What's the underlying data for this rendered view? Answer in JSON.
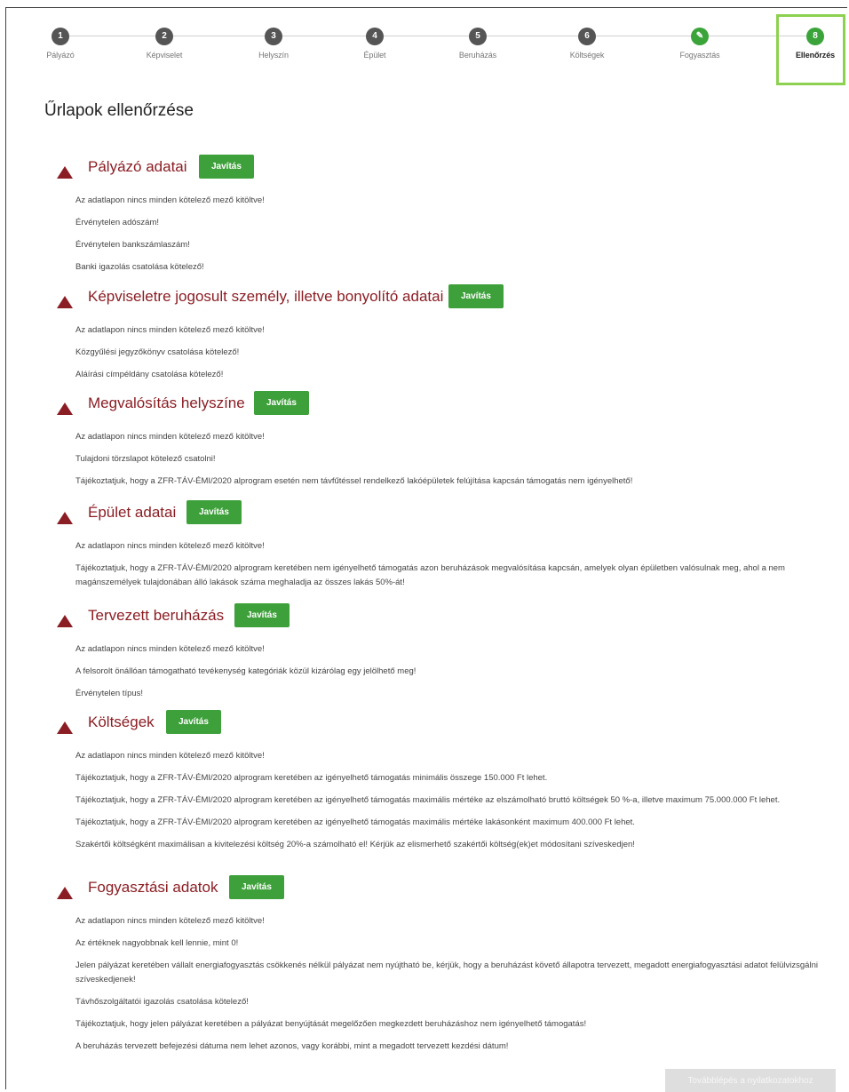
{
  "stepper": {
    "steps": [
      {
        "number": "1",
        "label": "Pályázó"
      },
      {
        "number": "2",
        "label": "Képviselet"
      },
      {
        "number": "3",
        "label": "Helyszín"
      },
      {
        "number": "4",
        "label": "Épület"
      },
      {
        "number": "5",
        "label": "Beruházás"
      },
      {
        "number": "6",
        "label": "Költségek"
      },
      {
        "number": "✎",
        "label": "Fogyasztás"
      },
      {
        "number": "8",
        "label": "Ellenőrzés"
      }
    ],
    "active_index": 7,
    "done_color": "#3aa43a",
    "active_border_color": "#8cd150"
  },
  "page_title": "Űrlapok ellenőrzése",
  "fix_button_label": "Javítás",
  "sections": [
    {
      "title": "Pályázó adatai",
      "messages": [
        "Az adatlapon nincs minden kötelező mező kitöltve!",
        "Érvénytelen adószám!",
        "Érvénytelen bankszámlaszám!",
        "Banki igazolás csatolása kötelező!"
      ]
    },
    {
      "title": "Képviseletre jogosult személy, illetve bonyolító adatai",
      "messages": [
        "Az adatlapon nincs minden kötelező mező kitöltve!",
        "Közgyűlési jegyzőkönyv csatolása kötelező!",
        "Aláírási címpéldány csatolása kötelező!"
      ]
    },
    {
      "title": "Megvalósítás helyszíne",
      "messages": [
        "Az adatlapon nincs minden kötelező mező kitöltve!",
        "Tulajdoni törzslapot kötelező csatolni!",
        "Tájékoztatjuk, hogy a ZFR-TÁV-ÉMI/2020 alprogram esetén nem távfűtéssel rendelkező lakóépületek felújítása kapcsán támogatás nem igényelhető!"
      ]
    },
    {
      "title": "Épület adatai",
      "messages": [
        "Az adatlapon nincs minden kötelező mező kitöltve!",
        "Tájékoztatjuk, hogy a ZFR-TÁV-ÉMI/2020 alprogram keretében nem igényelhető támogatás azon beruházások megvalósítása kapcsán, amelyek olyan épületben valósulnak meg, ahol a nem magánszemélyek tulajdonában álló lakások száma meghaladja az összes lakás 50%-át!"
      ]
    },
    {
      "title": "Tervezett beruházás",
      "messages": [
        "Az adatlapon nincs minden kötelező mező kitöltve!",
        "A felsorolt önállóan támogatható tevékenység kategóriák közül kizárólag egy jelölhető meg!",
        "Érvénytelen típus!"
      ]
    },
    {
      "title": "Költségek",
      "messages": [
        "Az adatlapon nincs minden kötelező mező kitöltve!",
        "Tájékoztatjuk, hogy a ZFR-TÁV-ÉMI/2020 alprogram keretében az igényelhető támogatás minimális összege 150.000 Ft lehet.",
        "Tájékoztatjuk, hogy a ZFR-TÁV-ÉMI/2020 alprogram keretében az igényelhető támogatás maximális mértéke az elszámolható bruttó költségek 50 %-a, illetve maximum 75.000.000 Ft lehet.",
        "Tájékoztatjuk, hogy a ZFR-TÁV-ÉMI/2020 alprogram keretében az igényelhető támogatás maximális mértéke lakásonként maximum 400.000 Ft lehet.",
        "Szakértői költségként maximálisan a kivitelezési költség 20%-a számolható el! Kérjük az elismerhető szakértői költség(ek)et módosítani szíveskedjen!"
      ]
    },
    {
      "title": "Fogyasztási adatok",
      "messages": [
        "Az adatlapon nincs minden kötelező mező kitöltve!",
        "Az értéknek nagyobbnak kell lennie, mint 0!",
        "Jelen pályázat keretében vállalt energiafogyasztás csökkenés nélkül pályázat nem nyújtható be, kérjük, hogy a beruházást követő állapotra tervezett, megadott energiafogyasztási adatot felülvizsgálni szíveskedjenek!",
        "Távhőszolgáltatói igazolás csatolása kötelező!",
        "Tájékoztatjuk, hogy jelen pályázat keretében a pályázat benyújtását megelőzően megkezdett beruházáshoz nem igényelhető támogatás!",
        "A beruházás tervezett befejezési dátuma nem lehet azonos, vagy korábbi, mint a megadott tervezett kezdési dátum!"
      ]
    }
  ],
  "next_button_label": "Továbblépés a nyilatkozatokhoz",
  "colors": {
    "section_title": "#8b1e24",
    "button_green": "#3da03a"
  }
}
